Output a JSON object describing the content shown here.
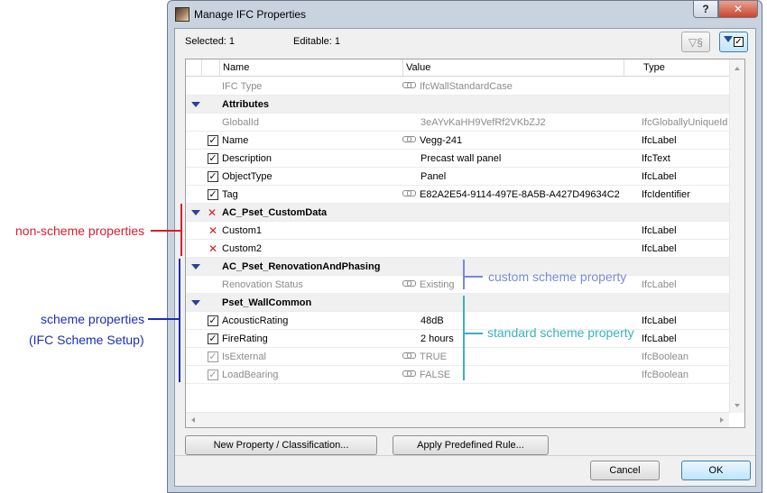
{
  "window": {
    "title": "Manage IFC Properties",
    "help_label": "?",
    "close_label": "✕"
  },
  "info": {
    "selected": "Selected: 1",
    "editable": "Editable: 1"
  },
  "toolbar": {
    "filter_label": "▽§"
  },
  "table": {
    "headers": {
      "name": "Name",
      "value": "Value",
      "type": "Type"
    },
    "rows": [
      {
        "kind": "item",
        "check": "",
        "name": "IFC Type",
        "value": "IfcWallStandardCase",
        "type": "",
        "muted": true,
        "link": true
      },
      {
        "kind": "group",
        "name": "Attributes",
        "marker": "triangle"
      },
      {
        "kind": "item",
        "check": "",
        "name": "GlobalId",
        "value": "3eAYvKaHH9VefRf2VKbZJ2",
        "type": "IfcGloballyUniqueId",
        "muted": true,
        "link": false
      },
      {
        "kind": "item",
        "check": "check",
        "name": "Name",
        "value": "Vegg-241",
        "type": "IfcLabel",
        "muted": false,
        "link": true
      },
      {
        "kind": "item",
        "check": "check",
        "name": "Description",
        "value": "Precast wall panel",
        "type": "IfcText",
        "muted": false,
        "link": false
      },
      {
        "kind": "item",
        "check": "check",
        "name": "ObjectType",
        "value": "Panel",
        "type": "IfcLabel",
        "muted": false,
        "link": false
      },
      {
        "kind": "item",
        "check": "check",
        "name": "Tag",
        "value": "E82A2E54-9114-497E-8A5B-A427D49634C2",
        "type": "IfcIdentifier",
        "muted": false,
        "link": true
      },
      {
        "kind": "group",
        "name": "AC_Pset_CustomData",
        "marker": "triangle-x"
      },
      {
        "kind": "item",
        "check": "x",
        "name": "Custom1",
        "value": "",
        "type": "IfcLabel",
        "muted": false,
        "link": false
      },
      {
        "kind": "item",
        "check": "x",
        "name": "Custom2",
        "value": "",
        "type": "IfcLabel",
        "muted": false,
        "link": false
      },
      {
        "kind": "group",
        "name": "AC_Pset_RenovationAndPhasing",
        "marker": "triangle"
      },
      {
        "kind": "item",
        "check": "",
        "name": "Renovation Status",
        "value": "Existing",
        "type": "IfcLabel",
        "muted": true,
        "link": true
      },
      {
        "kind": "group",
        "name": "Pset_WallCommon",
        "marker": "triangle"
      },
      {
        "kind": "item",
        "check": "check",
        "name": "AcousticRating",
        "value": "48dB",
        "type": "IfcLabel",
        "muted": false,
        "link": false
      },
      {
        "kind": "item",
        "check": "check",
        "name": "FireRating",
        "value": "2 hours",
        "type": "IfcLabel",
        "muted": false,
        "link": false
      },
      {
        "kind": "item",
        "check": "check-dim",
        "name": "IsExternal",
        "value": "TRUE",
        "type": "IfcBoolean",
        "muted": true,
        "link": true
      },
      {
        "kind": "item",
        "check": "check-dim",
        "name": "LoadBearing",
        "value": "FALSE",
        "type": "IfcBoolean",
        "muted": true,
        "link": true
      }
    ]
  },
  "buttons": {
    "new_property": "New Property / Classification...",
    "apply_rule": "Apply Predefined Rule...",
    "cancel": "Cancel",
    "ok": "OK"
  },
  "annotations": {
    "non_scheme": "non-scheme properties",
    "scheme": "scheme properties",
    "scheme_sub": "(IFC Scheme Setup)",
    "custom_scheme": "custom scheme property",
    "standard_scheme": "standard scheme property"
  },
  "colors": {
    "non_scheme": "#d81e2a",
    "scheme": "#1b2fb8",
    "custom_scheme": "#7a88d8",
    "standard_scheme": "#3ab0ba"
  }
}
